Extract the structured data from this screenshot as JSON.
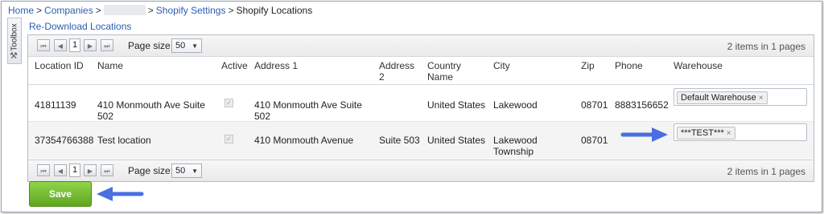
{
  "breadcrumb": {
    "home": "Home",
    "companies": "Companies",
    "sep": ">",
    "settings": "Shopify Settings",
    "current": "Shopify Locations"
  },
  "toolbox": {
    "label": "Toolbox",
    "icon": "wrench-icon"
  },
  "actions": {
    "redownload": "Re-Download Locations",
    "save": "Save"
  },
  "pager": {
    "page": "1",
    "page_size_label": "Page size:",
    "page_size": "50",
    "info": "2 items in 1 pages"
  },
  "columns": [
    "Location ID",
    "Name",
    "Active",
    "Address 1",
    "Address 2",
    "Country Name",
    "City",
    "Zip",
    "Phone",
    "Warehouse"
  ],
  "rows": [
    {
      "location_id": "41811139",
      "name": "410 Monmouth Ave Suite 502",
      "active": true,
      "address1": "410 Monmouth Ave Suite 502",
      "address2": "",
      "country": "United States",
      "city": "Lakewood",
      "zip": "08701",
      "phone": "8883156652",
      "warehouse": "Default Warehouse"
    },
    {
      "location_id": "37354766388",
      "name": "Test location",
      "active": true,
      "address1": "410 Monmouth Avenue",
      "address2": "Suite 503",
      "country": "United States",
      "city": "Lakewood Township",
      "zip": "08701",
      "phone": "",
      "warehouse": "***TEST***"
    }
  ],
  "colors": {
    "link": "#2a5db0",
    "save_button": "#6fb52c",
    "arrow": "#4a6fe0"
  }
}
